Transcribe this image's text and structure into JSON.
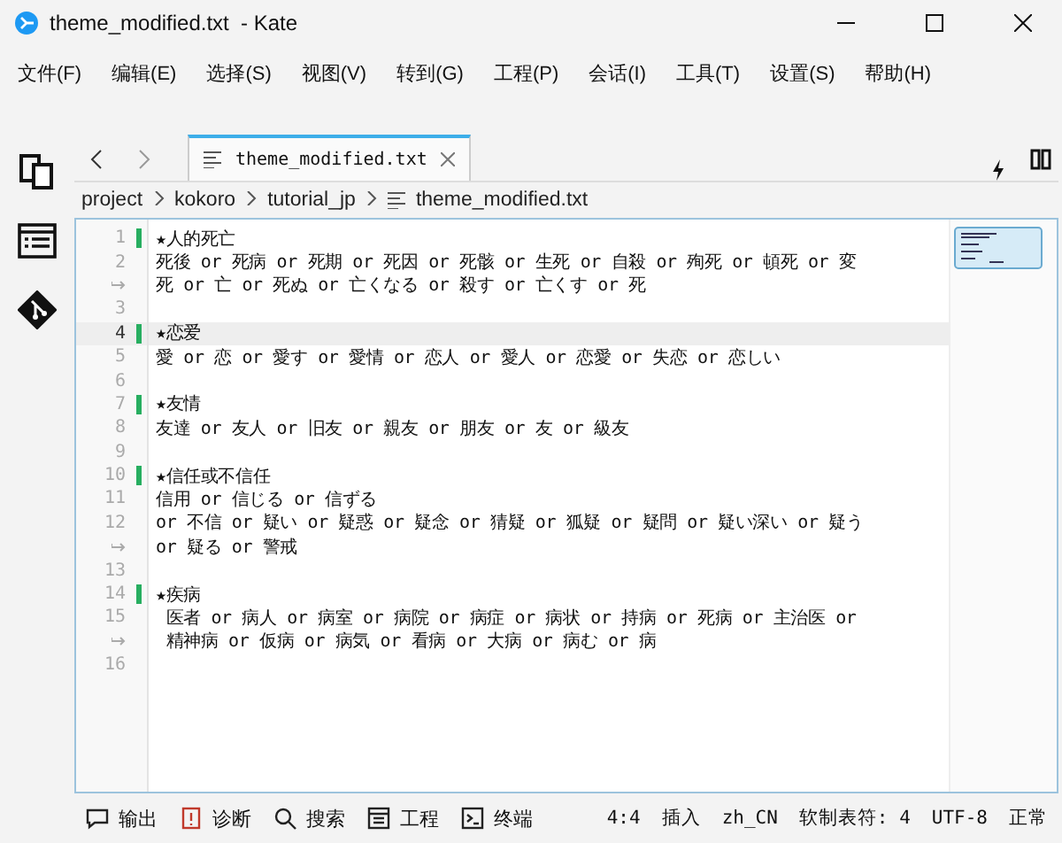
{
  "window": {
    "title": "theme_modified.txt  - Kate"
  },
  "menu": [
    "文件(F)",
    "编辑(E)",
    "选择(S)",
    "视图(V)",
    "转到(G)",
    "工程(P)",
    "会话(I)",
    "工具(T)",
    "设置(S)",
    "帮助(H)"
  ],
  "tabs": [
    {
      "label": "theme_modified.txt",
      "selected": true
    }
  ],
  "breadcrumb": [
    "project",
    "kokoro",
    "tutorial_jp",
    "theme_modified.txt"
  ],
  "lines": [
    {
      "kind": "line",
      "number": "1",
      "text": "★人的死亡",
      "modified": true,
      "current": false
    },
    {
      "kind": "line",
      "number": "2",
      "text": "死後 or 死病 or 死期 or 死因 or 死骸 or 生死 or 自殺 or 殉死 or 頓死 or 変",
      "modified": false,
      "current": false
    },
    {
      "kind": "wrap",
      "text": "死 or 亡 or 死ぬ or 亡くなる or 殺す or 亡くす or 死",
      "modified": false
    },
    {
      "kind": "line",
      "number": "3",
      "modified": false,
      "current": false
    },
    {
      "kind": "line",
      "number": "4",
      "text": "★恋爱",
      "modified": true,
      "current": true
    },
    {
      "kind": "line",
      "number": "5",
      "text": "愛 or 恋 or 愛す or 愛情 or 恋人 or 愛人 or 恋愛 or 失恋 or 恋しい",
      "modified": false,
      "current": false
    },
    {
      "kind": "line",
      "number": "6",
      "modified": false,
      "current": false
    },
    {
      "kind": "line",
      "number": "7",
      "text": "★友情",
      "modified": true,
      "current": false
    },
    {
      "kind": "line",
      "number": "8",
      "text": "友達 or 友人 or 旧友 or 親友 or 朋友 or 友 or 級友",
      "modified": false,
      "current": false
    },
    {
      "kind": "line",
      "number": "9",
      "modified": false,
      "current": false
    },
    {
      "kind": "line",
      "number": "10",
      "text": "★信任或不信任",
      "modified": true,
      "current": false
    },
    {
      "kind": "line",
      "number": "11",
      "text": "信用 or 信じる or 信ずる",
      "modified": false,
      "current": false
    },
    {
      "kind": "line",
      "number": "12",
      "text": "or 不信 or 疑い or 疑惑 or 疑念 or 猜疑 or 狐疑 or 疑問 or 疑い深い or 疑う",
      "modified": false,
      "current": false
    },
    {
      "kind": "wrap",
      "text": "or 疑る or 警戒",
      "modified": false
    },
    {
      "kind": "line",
      "number": "13",
      "modified": false,
      "current": false
    },
    {
      "kind": "line",
      "number": "14",
      "text": "★疾病",
      "modified": true,
      "current": false
    },
    {
      "kind": "line",
      "number": "15",
      "text": " 医者 or 病人 or 病室 or 病院 or 病症 or 病状 or 持病 or 死病 or 主治医 or",
      "modified": false,
      "current": false
    },
    {
      "kind": "wrap",
      "text": " 精神病 or 仮病 or 病気 or 看病 or 大病 or 病む or 病",
      "modified": false
    },
    {
      "kind": "line",
      "number": "16",
      "modified": false,
      "current": false
    }
  ],
  "toolviews": [
    {
      "kind": "output",
      "label": "输出"
    },
    {
      "kind": "diagnostics",
      "label": "诊断"
    },
    {
      "kind": "search",
      "label": "搜索"
    },
    {
      "kind": "project",
      "label": "工程"
    },
    {
      "kind": "terminal",
      "label": "终端"
    }
  ],
  "status": [
    "4:4",
    "插入",
    "zh_CN",
    "软制表符: 4",
    "UTF-8",
    "正常"
  ]
}
